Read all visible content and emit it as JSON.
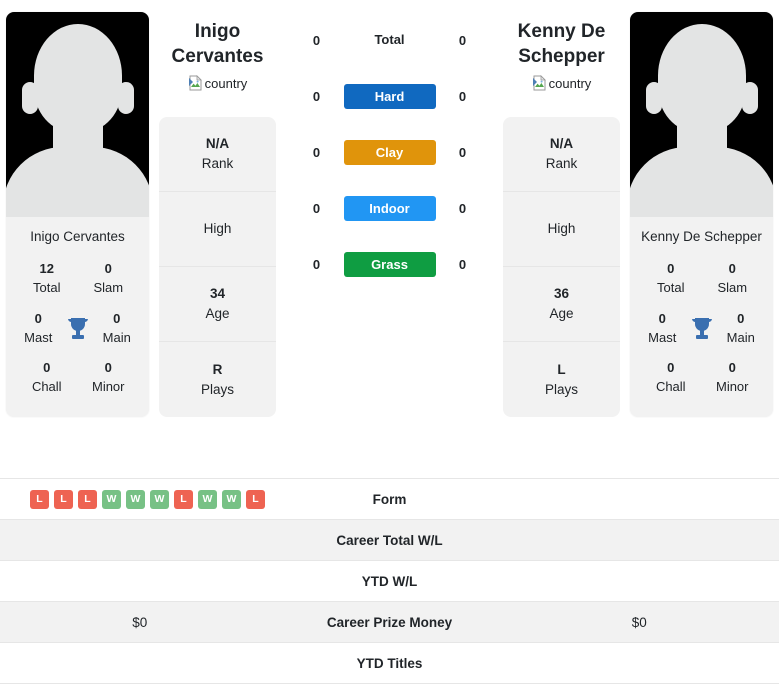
{
  "players": [
    {
      "name": "Inigo Cervantes",
      "name_line1": "Inigo",
      "name_line2": "Cervantes",
      "country_alt": "country",
      "card_name": "Inigo Cervantes",
      "titles": {
        "total": "12",
        "total_label": "Total",
        "slam": "0",
        "slam_label": "Slam",
        "mast": "0",
        "mast_label": "Mast",
        "main": "0",
        "main_label": "Main",
        "chall": "0",
        "chall_label": "Chall",
        "minor": "0",
        "minor_label": "Minor"
      },
      "rank_card": [
        {
          "value": "N/A",
          "label": "Rank"
        },
        {
          "value": "",
          "label": "High"
        },
        {
          "value": "34",
          "label": "Age"
        },
        {
          "value": "R",
          "label": "Plays"
        }
      ],
      "surface_values": {
        "total": "0",
        "hard": "0",
        "clay": "0",
        "indoor": "0",
        "grass": "0"
      },
      "form": [
        "L",
        "L",
        "L",
        "W",
        "W",
        "W",
        "L",
        "W",
        "W",
        "L"
      ],
      "career_total_wl": "",
      "ytd_wl": "",
      "career_prize_money": "$0",
      "ytd_titles": ""
    },
    {
      "name": "Kenny De Schepper",
      "name_line1": "Kenny De",
      "name_line2": "Schepper",
      "country_alt": "country",
      "card_name": "Kenny De Schepper",
      "titles": {
        "total": "0",
        "total_label": "Total",
        "slam": "0",
        "slam_label": "Slam",
        "mast": "0",
        "mast_label": "Mast",
        "main": "0",
        "main_label": "Main",
        "chall": "0",
        "chall_label": "Chall",
        "minor": "0",
        "minor_label": "Minor"
      },
      "rank_card": [
        {
          "value": "N/A",
          "label": "Rank"
        },
        {
          "value": "",
          "label": "High"
        },
        {
          "value": "36",
          "label": "Age"
        },
        {
          "value": "L",
          "label": "Plays"
        }
      ],
      "surface_values": {
        "total": "0",
        "hard": "0",
        "clay": "0",
        "indoor": "0",
        "grass": "0"
      },
      "form": [],
      "career_total_wl": "",
      "ytd_wl": "",
      "career_prize_money": "$0",
      "ytd_titles": ""
    }
  ],
  "surfaces": [
    {
      "key": "total",
      "label": "Total",
      "badge": false,
      "color": ""
    },
    {
      "key": "hard",
      "label": "Hard",
      "badge": true,
      "color": "#1069c0"
    },
    {
      "key": "clay",
      "label": "Clay",
      "badge": true,
      "color": "#e0940b"
    },
    {
      "key": "indoor",
      "label": "Indoor",
      "badge": true,
      "color": "#2196f3"
    },
    {
      "key": "grass",
      "label": "Grass",
      "badge": true,
      "color": "#0f9d42"
    }
  ],
  "comparison_rows": [
    {
      "label": "Form",
      "key": "form"
    },
    {
      "label": "Career Total W/L",
      "key": "career_total_wl"
    },
    {
      "label": "YTD W/L",
      "key": "ytd_wl"
    },
    {
      "label": "Career Prize Money",
      "key": "career_prize_money"
    },
    {
      "label": "YTD Titles",
      "key": "ytd_titles"
    }
  ],
  "colors": {
    "win": "#77c185",
    "loss": "#ee6352",
    "trophy": "#3a6fb0",
    "card_bg": "#f2f2f2",
    "avatar_bg": "#000000",
    "silhouette": "#e3e4e4"
  }
}
